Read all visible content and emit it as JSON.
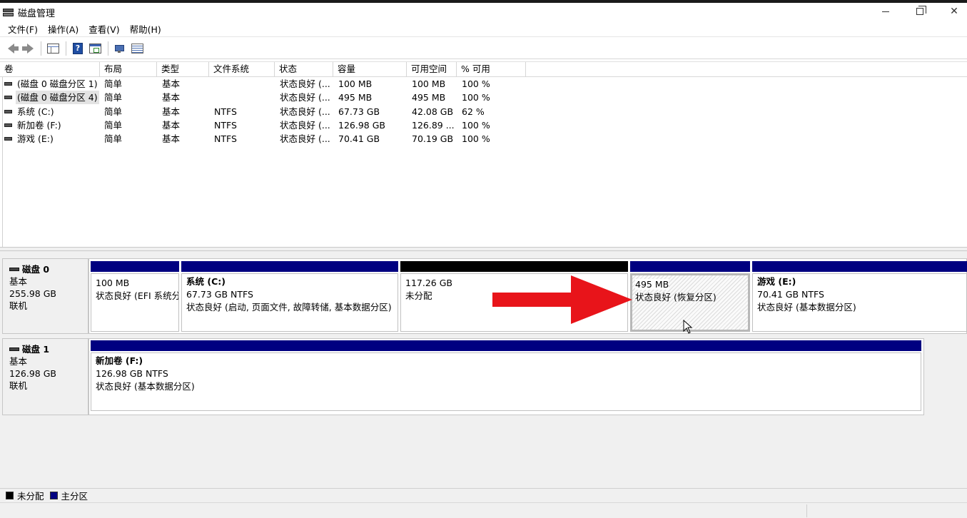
{
  "window": {
    "title": "磁盘管理"
  },
  "menu": [
    "文件(F)",
    "操作(A)",
    "查看(V)",
    "帮助(H)"
  ],
  "toolbar": {
    "icons": [
      "back-arrow-icon",
      "forward-arrow-icon",
      "console-tree-icon",
      "help-icon",
      "properties-window-icon",
      "connect-icon",
      "list-view-icon"
    ]
  },
  "volume_table": {
    "columns": [
      "卷",
      "布局",
      "类型",
      "文件系统",
      "状态",
      "容量",
      "可用空间",
      "% 可用"
    ],
    "rows": [
      [
        "(磁盘 0 磁盘分区 1)",
        "简单",
        "基本",
        "",
        "状态良好 (...",
        "100 MB",
        "100 MB",
        "100 %"
      ],
      [
        "(磁盘 0 磁盘分区 4)",
        "简单",
        "基本",
        "",
        "状态良好 (...",
        "495 MB",
        "495 MB",
        "100 %"
      ],
      [
        "系统 (C:)",
        "简单",
        "基本",
        "NTFS",
        "状态良好 (...",
        "67.73 GB",
        "42.08 GB",
        "62 %"
      ],
      [
        "新加卷 (F:)",
        "简单",
        "基本",
        "NTFS",
        "状态良好 (...",
        "126.98 GB",
        "126.89 ...",
        "100 %"
      ],
      [
        "游戏 (E:)",
        "简单",
        "基本",
        "NTFS",
        "状态良好 (...",
        "70.41 GB",
        "70.19 GB",
        "100 %"
      ]
    ],
    "selected_row": 1
  },
  "disks": [
    {
      "name": "磁盘 0",
      "type": "基本",
      "size": "255.98 GB",
      "status": "联机",
      "partitions": [
        {
          "name": "",
          "size": "100 MB",
          "status": "状态良好 (EFI 系统分",
          "kind": "primary"
        },
        {
          "name": "系统 (C:)",
          "size": "67.73 GB NTFS",
          "status": "状态良好 (启动, 页面文件, 故障转储, 基本数据分区)",
          "kind": "primary"
        },
        {
          "name": "",
          "size": "117.26 GB",
          "status": "未分配",
          "kind": "unallocated"
        },
        {
          "name": "",
          "size": "495 MB",
          "status": "状态良好 (恢复分区)",
          "kind": "primary",
          "selected": true
        },
        {
          "name": "游戏  (E:)",
          "size": "70.41 GB NTFS",
          "status": "状态良好 (基本数据分区)",
          "kind": "primary"
        }
      ]
    },
    {
      "name": "磁盘 1",
      "type": "基本",
      "size": "126.98 GB",
      "status": "联机",
      "partitions": [
        {
          "name": "新加卷  (F:)",
          "size": "126.98 GB NTFS",
          "status": "状态良好 (基本数据分区)",
          "kind": "primary"
        }
      ]
    }
  ],
  "legend": [
    {
      "label": "未分配",
      "color": "#000000"
    },
    {
      "label": "主分区",
      "color": "#000080"
    }
  ],
  "colors": {
    "primary": "#000080",
    "unallocated": "#000000",
    "annotation_arrow": "#e8141a"
  }
}
